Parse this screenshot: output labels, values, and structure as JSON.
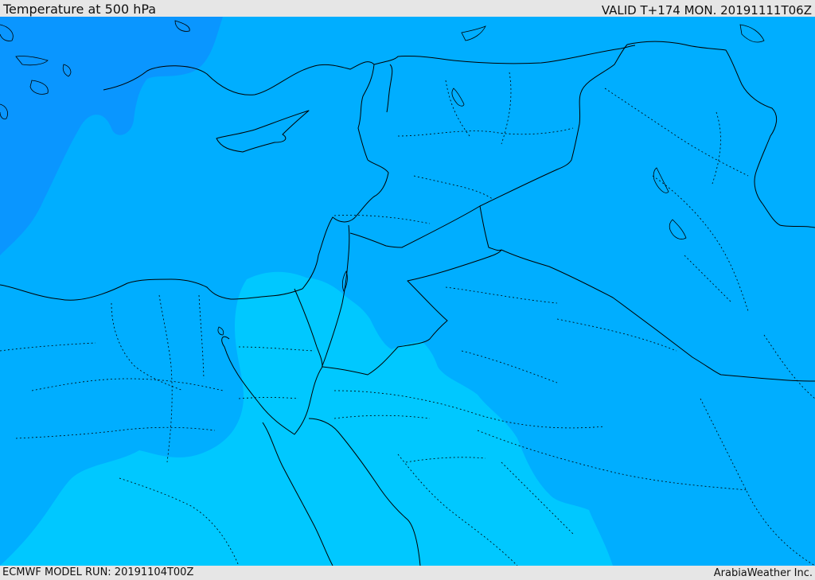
{
  "header": {
    "title": "Temperature at 500 hPa",
    "valid_time": "VALID T+174 MON. 20191111T06Z"
  },
  "footer": {
    "model_run": "ECMWF MODEL RUN: 20191104T00Z",
    "credit": "ArabiaWeather Inc."
  },
  "map": {
    "shading_colors": {
      "deep": "#0a96ff",
      "medium": "#00aeff",
      "light": "#00c8ff"
    },
    "border_color": "#000000"
  }
}
